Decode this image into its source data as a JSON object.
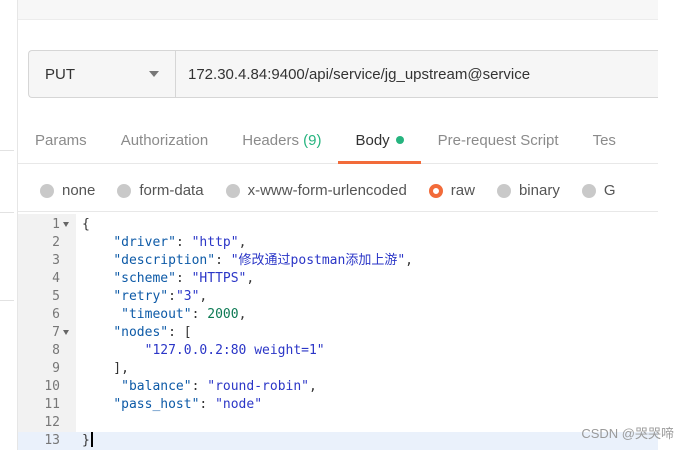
{
  "request": {
    "method": "PUT",
    "url": "172.30.4.84:9400/api/service/jg_upstream@service"
  },
  "tabs": [
    {
      "label": "Params"
    },
    {
      "label": "Authorization"
    },
    {
      "label": "Headers",
      "count": "(9)"
    },
    {
      "label": "Body",
      "active": true
    },
    {
      "label": "Pre-request Script"
    },
    {
      "label": "Tes"
    }
  ],
  "body_types": [
    {
      "label": "none"
    },
    {
      "label": "form-data"
    },
    {
      "label": "x-www-form-urlencoded"
    },
    {
      "label": "raw",
      "selected": true
    },
    {
      "label": "binary"
    },
    {
      "label": "G"
    }
  ],
  "editor": {
    "lines": [
      {
        "num": "1",
        "fold": true,
        "code": "{"
      },
      {
        "num": "2",
        "code": "    \"driver\": \"http\","
      },
      {
        "num": "3",
        "code": "    \"description\": \"修改通过postman添加上游\","
      },
      {
        "num": "4",
        "code": "    \"scheme\": \"HTTPS\","
      },
      {
        "num": "5",
        "code": "    \"retry\":\"3\","
      },
      {
        "num": "6",
        "code": "     \"timeout\": 2000,"
      },
      {
        "num": "7",
        "fold": true,
        "code": "    \"nodes\": ["
      },
      {
        "num": "8",
        "code": "        \"127.0.0.2:80 weight=1\""
      },
      {
        "num": "9",
        "code": "    ],"
      },
      {
        "num": "10",
        "code": "     \"balance\": \"round-robin\","
      },
      {
        "num": "11",
        "code": "    \"pass_host\": \"node\""
      },
      {
        "num": "12",
        "code": ""
      },
      {
        "num": "13",
        "code": "}",
        "current": true
      }
    ]
  },
  "watermark": "CSDN @哭哭啼"
}
